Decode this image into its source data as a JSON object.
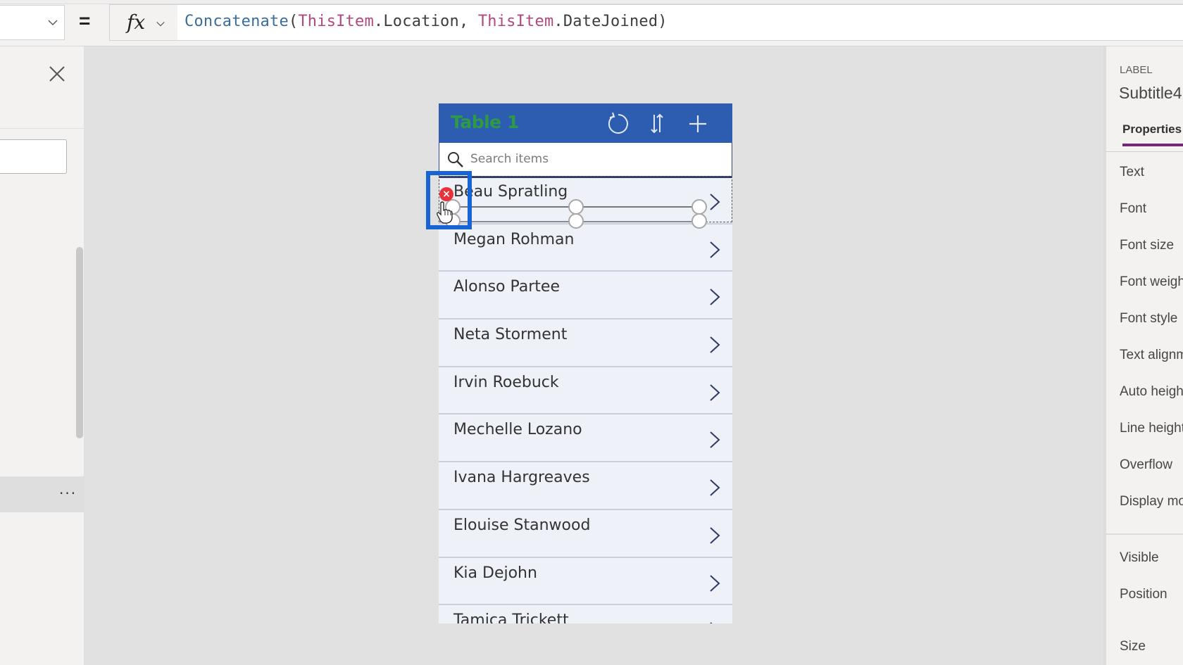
{
  "formula_bar": {
    "property_value": "",
    "equals": "=",
    "fx_label": "fx",
    "formula": {
      "fn": "Concatenate",
      "open": "(",
      "arg1_obj": "ThisItem",
      "arg1_field": ".Location",
      "sep": ", ",
      "arg2_obj": "ThisItem",
      "arg2_field": ".DateJoined",
      "close": ")"
    }
  },
  "left_panel": {
    "close_icon": "close-icon",
    "input_value": "",
    "more_label": "···"
  },
  "gallery": {
    "title": "Table 1",
    "header_icons": [
      "refresh-icon",
      "sort-icon",
      "add-icon"
    ],
    "search": {
      "placeholder": "Search items",
      "value": ""
    },
    "items": [
      {
        "name": "Beau Spratling"
      },
      {
        "name": "Megan Rohman"
      },
      {
        "name": "Alonso Partee"
      },
      {
        "name": "Neta Storment"
      },
      {
        "name": "Irvin Roebuck"
      },
      {
        "name": "Mechelle Lozano"
      },
      {
        "name": "Ivana Hargreaves"
      },
      {
        "name": "Elouise Stanwood"
      },
      {
        "name": "Kia Dejohn"
      },
      {
        "name": "Tamica Trickett"
      }
    ],
    "selected_item_index": 0,
    "delete_badge": "×"
  },
  "right_panel": {
    "control_type": "LABEL",
    "control_name": "Subtitle4",
    "active_tab": "Properties",
    "properties_group1": [
      "Text",
      "Font",
      "Font size",
      "Font weight",
      "Font style",
      "Text alignment",
      "Auto height",
      "Line height",
      "Overflow",
      "Display mode"
    ],
    "properties_group2": [
      "Visible",
      "Position",
      "Size"
    ]
  },
  "colors": {
    "header_bg": "#2d5db0",
    "title_text": "#2e9a45",
    "selection_focus": "#1764d6",
    "delete_badge": "#e8323a",
    "tab_underline": "#742774",
    "row_bg": "#eef1f8"
  }
}
